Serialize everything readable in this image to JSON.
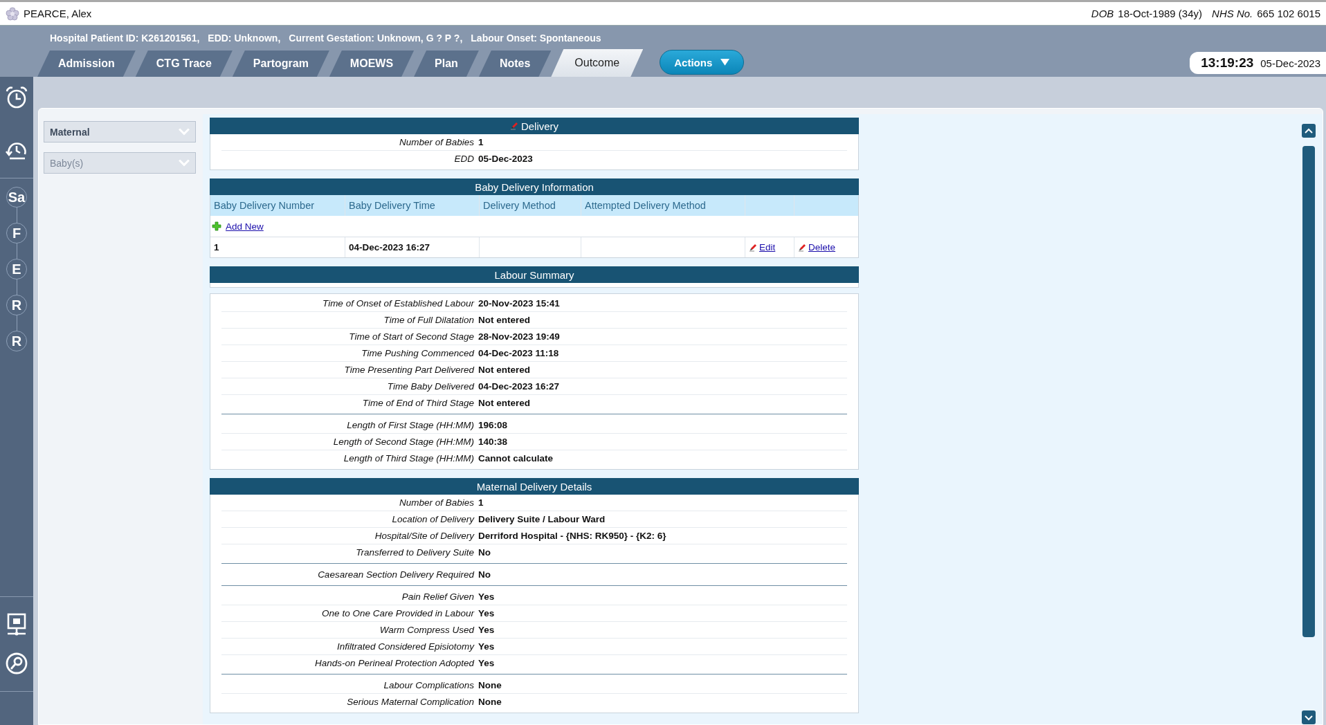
{
  "patient": {
    "name": "PEARCE, Alex",
    "dob_label": "DOB",
    "dob": "18-Oct-1989 (34y)",
    "nhs_label": "NHS No.",
    "nhs": "665 102 6015"
  },
  "banner": [
    "Hospital Patient ID: K261201561,",
    "EDD: Unknown,",
    "Current Gestation: Unknown, G ? P ?,",
    "Labour Onset: Spontaneous"
  ],
  "tabs": [
    {
      "label": "Admission",
      "selected": false
    },
    {
      "label": "CTG Trace",
      "selected": false
    },
    {
      "label": "Partogram",
      "selected": false
    },
    {
      "label": "MOEWS",
      "selected": false
    },
    {
      "label": "Plan",
      "selected": false
    },
    {
      "label": "Notes",
      "selected": false
    },
    {
      "label": "Outcome",
      "selected": true
    }
  ],
  "actions_button": "Actions",
  "clock": {
    "time": "13:19:23",
    "date": "05-Dec-2023"
  },
  "sidebar": {
    "steps": [
      "Sa",
      "F",
      "E",
      "R",
      "R"
    ]
  },
  "filters": [
    {
      "label": "Maternal",
      "disabled": false
    },
    {
      "label": "Baby(s)",
      "disabled": true
    }
  ],
  "sections": [
    {
      "kind": "fields",
      "title": "Delivery",
      "editable": true,
      "detached": false,
      "groups": [
        [
          {
            "label": "Number of Babies",
            "value": "1"
          },
          {
            "label": "EDD",
            "value": "05-Dec-2023"
          }
        ]
      ]
    },
    {
      "kind": "table",
      "title": "Baby Delivery Information",
      "editable": false,
      "columns": [
        "Baby Delivery Number",
        "Baby Delivery Time",
        "Delivery Method",
        "Attempted Delivery Method"
      ],
      "add_new": "Add New",
      "rows": [
        {
          "cells": [
            "1",
            "04-Dec-2023 16:27"
          ],
          "edit": "Edit",
          "delete": "Delete"
        }
      ]
    },
    {
      "kind": "fields",
      "title": "Labour Summary",
      "editable": false,
      "detached": true,
      "groups": [
        [
          {
            "label": "Time of Onset of Established Labour",
            "value": "20-Nov-2023 15:41"
          },
          {
            "label": "Time of Full Dilatation",
            "value": "Not entered"
          },
          {
            "label": "Time of Start of Second Stage",
            "value": "28-Nov-2023 19:49"
          },
          {
            "label": "Time Pushing Commenced",
            "value": "04-Dec-2023 11:18"
          },
          {
            "label": "Time Presenting Part Delivered",
            "value": "Not entered"
          },
          {
            "label": "Time Baby Delivered",
            "value": "04-Dec-2023 16:27"
          },
          {
            "label": "Time of End of Third Stage",
            "value": "Not entered"
          }
        ],
        [
          {
            "label": "Length of First Stage (HH:MM)",
            "value": "196:08"
          },
          {
            "label": "Length of Second Stage (HH:MM)",
            "value": "140:38"
          },
          {
            "label": "Length of Third Stage (HH:MM)",
            "value": "Cannot calculate"
          }
        ]
      ]
    },
    {
      "kind": "fields",
      "title": "Maternal Delivery Details",
      "editable": false,
      "detached": false,
      "groups": [
        [
          {
            "label": "Number of Babies",
            "value": "1"
          },
          {
            "label": "Location of Delivery",
            "value": "Delivery Suite / Labour Ward"
          },
          {
            "label": "Hospital/Site of Delivery",
            "value": "Derriford Hospital - {NHS: RK950} - {K2: 6}"
          },
          {
            "label": "Transferred to Delivery Suite",
            "value": "No"
          }
        ],
        [
          {
            "label": "Caesarean Section Delivery Required",
            "value": "No"
          }
        ],
        [
          {
            "label": "Pain Relief Given",
            "value": "Yes"
          },
          {
            "label": "One to One Care Provided in Labour",
            "value": "Yes"
          },
          {
            "label": "Warm Compress Used",
            "value": "Yes"
          },
          {
            "label": "Infiltrated Considered Episiotomy",
            "value": "Yes"
          },
          {
            "label": "Hands-on Perineal Protection Adopted",
            "value": "Yes"
          }
        ],
        [
          {
            "label": "Labour Complications",
            "value": "None"
          },
          {
            "label": "Serious Maternal Complication",
            "value": "None"
          }
        ]
      ]
    }
  ]
}
